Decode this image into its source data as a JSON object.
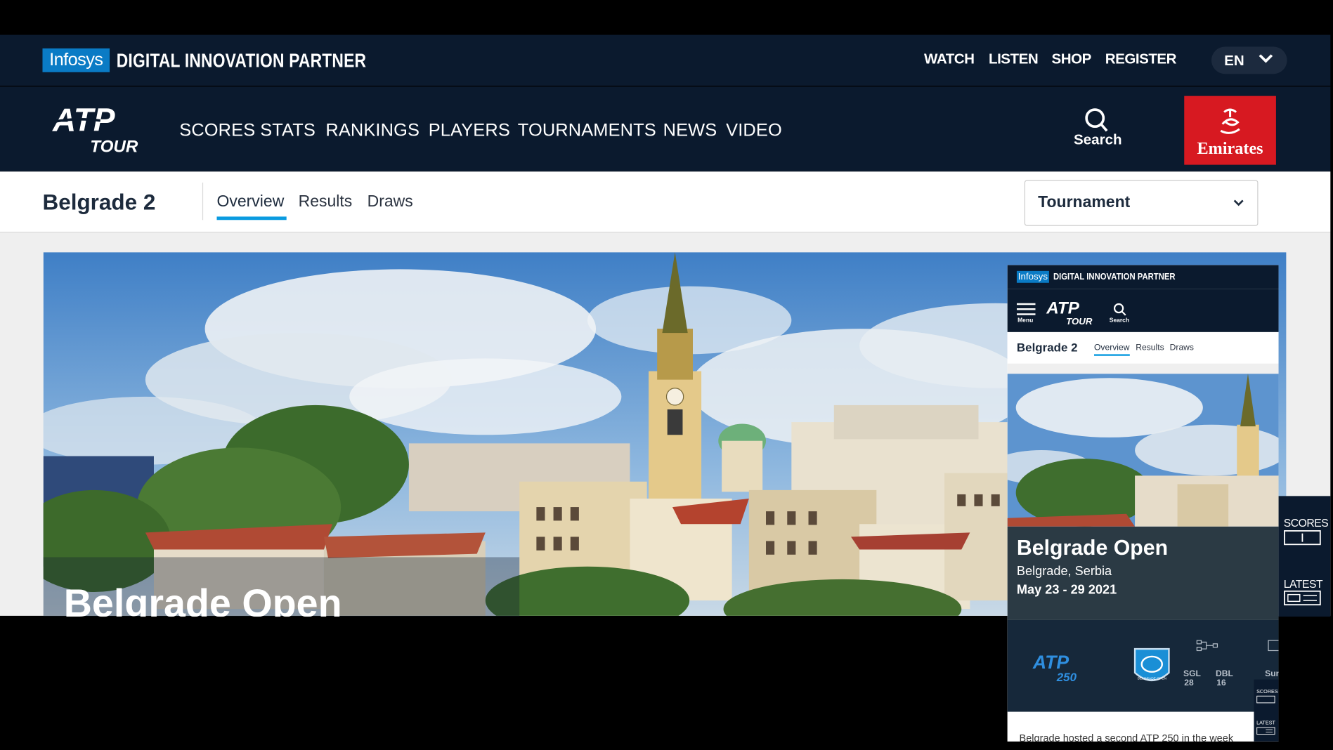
{
  "topbar": {
    "partner_logo": "Infosys",
    "partner_text": "DIGITAL INNOVATION PARTNER",
    "links": [
      "WATCH",
      "LISTEN",
      "SHOP",
      "REGISTER"
    ],
    "language": "EN"
  },
  "mainnav": {
    "logo_top": "ATP",
    "logo_bottom": "TOUR",
    "items": [
      "SCORES",
      "STATS",
      "RANKINGS",
      "PLAYERS",
      "TOURNAMENTS",
      "NEWS",
      "VIDEO"
    ],
    "search_label": "Search",
    "sponsor": "Emirates"
  },
  "subnav": {
    "title": "Belgrade 2",
    "tabs": [
      "Overview",
      "Results",
      "Draws"
    ],
    "active_tab": "Overview",
    "select_label": "Tournament"
  },
  "hero": {
    "title": "Belgrade Open"
  },
  "floating": {
    "scores": "SCORES",
    "latest": "LATEST"
  },
  "mobile_preview": {
    "partner_logo": "Infosys",
    "partner_text": "DIGITAL INNOVATION PARTNER",
    "menu": "Menu",
    "logo_top": "ATP",
    "logo_bottom": "TOUR",
    "search": "Search",
    "title": "Belgrade 2",
    "tabs": [
      "Overview",
      "Results",
      "Draws"
    ],
    "tournament_name": "Belgrade Open",
    "location": "Belgrade, Serbia",
    "dates": "May 23 - 29 2021",
    "badge_top": "ATP",
    "badge_level": "250",
    "event_logo_text": "BELGRADE OPEN",
    "stats": [
      {
        "label": "SGL",
        "value": "28"
      },
      {
        "label": "DBL",
        "value": "16"
      }
    ],
    "surface_partial": "Sur",
    "floating_scores": "SCORES",
    "floating_latest": "LATEST",
    "body_partial": "Belgrade hosted a second ATP 250 in the week"
  },
  "colors": {
    "navy": "#0b1a2e",
    "infosys_blue": "#0a7bc5",
    "active_tab": "#0a9be0",
    "emirates_red": "#d71921"
  }
}
